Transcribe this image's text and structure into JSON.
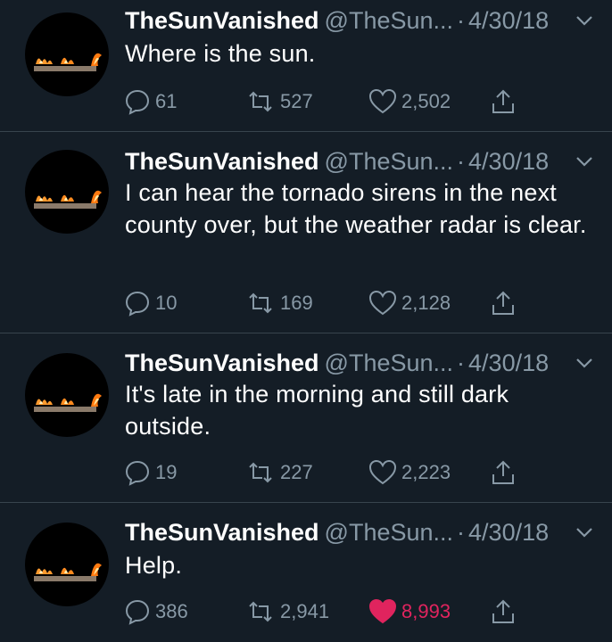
{
  "colors": {
    "background": "#141d26",
    "text": "#ffffff",
    "muted": "#8899a6",
    "like_active": "#e0245e",
    "divider": "#38444d"
  },
  "tweets": [
    {
      "name": "TheSunVanished",
      "handle": "@TheSun...",
      "sep": "·",
      "date": "4/30/18",
      "text": "Where is the sun.",
      "replies": "61",
      "retweets": "527",
      "likes": "2,502",
      "liked": false,
      "icons": [
        "reply-icon",
        "retweet-icon",
        "heart-icon",
        "share-icon",
        "chevron-down-icon"
      ]
    },
    {
      "name": "TheSunVanished",
      "handle": "@TheSun...",
      "sep": "·",
      "date": "4/30/18",
      "text": "I can hear the tornado sirens in the next county over, but the weather radar is clear.",
      "replies": "10",
      "retweets": "169",
      "likes": "2,128",
      "liked": false
    },
    {
      "name": "TheSunVanished",
      "handle": "@TheSun...",
      "sep": "·",
      "date": "4/30/18",
      "text": "It's late in the morning and still dark outside.",
      "replies": "19",
      "retweets": "227",
      "likes": "2,223",
      "liked": false
    },
    {
      "name": "TheSunVanished",
      "handle": "@TheSun...",
      "sep": "·",
      "date": "4/30/18",
      "text": "Help.",
      "replies": "386",
      "retweets": "2,941",
      "likes": "8,993",
      "liked": true
    }
  ]
}
